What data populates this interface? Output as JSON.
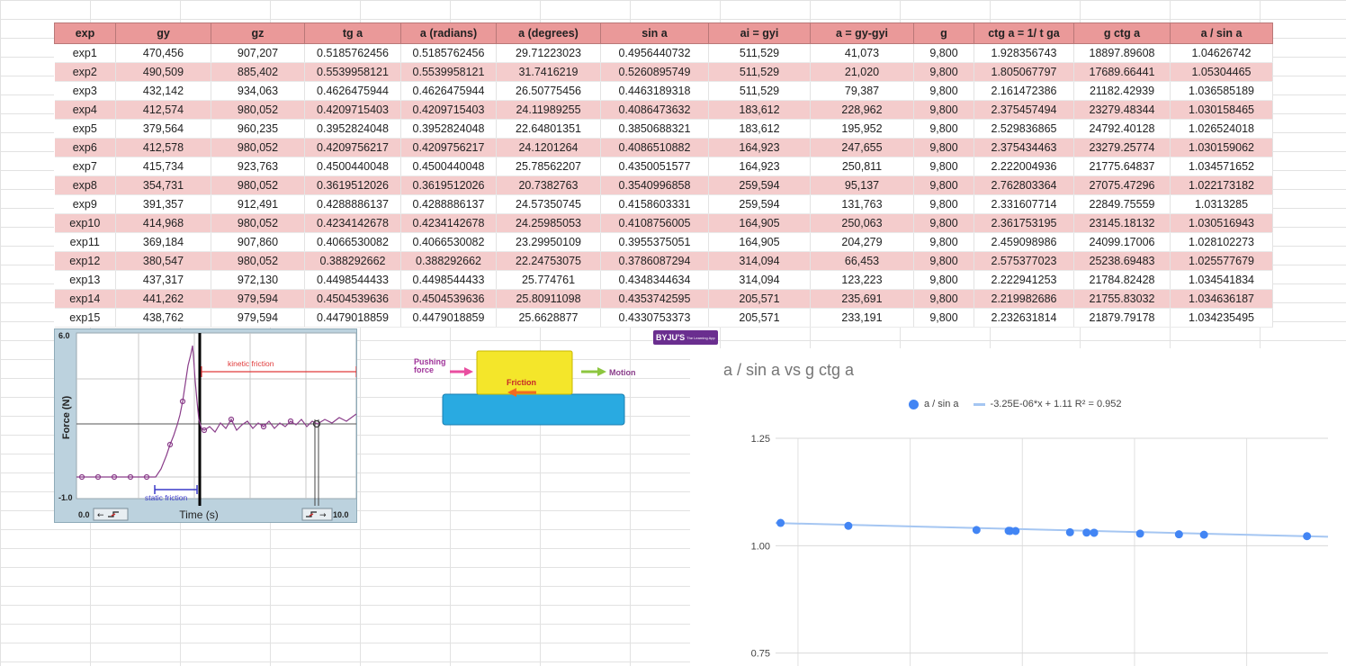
{
  "table": {
    "headers": [
      "exp",
      "gy",
      "gz",
      "tg a",
      "a (radians)",
      "a (degrees)",
      "sin a",
      "ai = gyi",
      "a = gy-gyi",
      "g",
      "ctg a = 1/ t ga",
      "g ctg a",
      "a / sin a"
    ],
    "col_widths": [
      68,
      106,
      104,
      107,
      106,
      116,
      120,
      113,
      115,
      67,
      111,
      107,
      114
    ],
    "rows": [
      [
        "exp1",
        "470,456",
        "907,207",
        "0.5185762456",
        "0.5185762456",
        "29.71223023",
        "0.4956440732",
        "511,529",
        "41,073",
        "9,800",
        "1.928356743",
        "18897.89608",
        "1.04626742"
      ],
      [
        "exp2",
        "490,509",
        "885,402",
        "0.5539958121",
        "0.5539958121",
        "31.7416219",
        "0.5260895749",
        "511,529",
        "21,020",
        "9,800",
        "1.805067797",
        "17689.66441",
        "1.05304465"
      ],
      [
        "exp3",
        "432,142",
        "934,063",
        "0.4626475944",
        "0.4626475944",
        "26.50775456",
        "0.4463189318",
        "511,529",
        "79,387",
        "9,800",
        "2.161472386",
        "21182.42939",
        "1.036585189"
      ],
      [
        "exp4",
        "412,574",
        "980,052",
        "0.4209715403",
        "0.4209715403",
        "24.11989255",
        "0.4086473632",
        "183,612",
        "228,962",
        "9,800",
        "2.375457494",
        "23279.48344",
        "1.030158465"
      ],
      [
        "exp5",
        "379,564",
        "960,235",
        "0.3952824048",
        "0.3952824048",
        "22.64801351",
        "0.3850688321",
        "183,612",
        "195,952",
        "9,800",
        "2.529836865",
        "24792.40128",
        "1.026524018"
      ],
      [
        "exp6",
        "412,578",
        "980,052",
        "0.4209756217",
        "0.4209756217",
        "24.1201264",
        "0.4086510882",
        "164,923",
        "247,655",
        "9,800",
        "2.375434463",
        "23279.25774",
        "1.030159062"
      ],
      [
        "exp7",
        "415,734",
        "923,763",
        "0.4500440048",
        "0.4500440048",
        "25.78562207",
        "0.4350051577",
        "164,923",
        "250,811",
        "9,800",
        "2.222004936",
        "21775.64837",
        "1.034571652"
      ],
      [
        "exp8",
        "354,731",
        "980,052",
        "0.3619512026",
        "0.3619512026",
        "20.7382763",
        "0.3540996858",
        "259,594",
        "95,137",
        "9,800",
        "2.762803364",
        "27075.47296",
        "1.022173182"
      ],
      [
        "exp9",
        "391,357",
        "912,491",
        "0.4288886137",
        "0.4288886137",
        "24.57350745",
        "0.4158603331",
        "259,594",
        "131,763",
        "9,800",
        "2.331607714",
        "22849.75559",
        "1.0313285"
      ],
      [
        "exp10",
        "414,968",
        "980,052",
        "0.4234142678",
        "0.4234142678",
        "24.25985053",
        "0.4108756005",
        "164,905",
        "250,063",
        "9,800",
        "2.361753195",
        "23145.18132",
        "1.030516943"
      ],
      [
        "exp11",
        "369,184",
        "907,860",
        "0.4066530082",
        "0.4066530082",
        "23.29950109",
        "0.3955375051",
        "164,905",
        "204,279",
        "9,800",
        "2.459098986",
        "24099.17006",
        "1.028102273"
      ],
      [
        "exp12",
        "380,547",
        "980,052",
        "0.388292662",
        "0.388292662",
        "22.24753075",
        "0.3786087294",
        "314,094",
        "66,453",
        "9,800",
        "2.575377023",
        "25238.69483",
        "1.025577679"
      ],
      [
        "exp13",
        "437,317",
        "972,130",
        "0.4498544433",
        "0.4498544433",
        "25.774761",
        "0.4348344634",
        "314,094",
        "123,223",
        "9,800",
        "2.222941253",
        "21784.82428",
        "1.034541834"
      ],
      [
        "exp14",
        "441,262",
        "979,594",
        "0.4504539636",
        "0.4504539636",
        "25.80911098",
        "0.4353742595",
        "205,571",
        "235,691",
        "9,800",
        "2.219982686",
        "21755.83032",
        "1.034636187"
      ],
      [
        "exp15",
        "438,762",
        "979,594",
        "0.4479018859",
        "0.4479018859",
        "25.6628877",
        "0.4330753373",
        "205,571",
        "233,191",
        "9,800",
        "2.232631814",
        "21879.79178",
        "1.034235495"
      ]
    ]
  },
  "friction_graph": {
    "y_axis_label": "Force (N)",
    "x_axis_label": "Time (s)",
    "y_max_label": "6.0",
    "y_min_label": "-1.0",
    "x_min_label": "0.0",
    "x_max_label": "10.0",
    "kinetic_label": "kinetic friction",
    "static_label": "static friction",
    "trace_color": "#8a3d8a",
    "kinetic_color": "#e03a3a",
    "static_color": "#3a3ac8"
  },
  "friction_diagram": {
    "pushing_label": "Pushing force",
    "pushing_line1": "Pushing",
    "pushing_line2": "force",
    "friction_label": "Friction",
    "motion_label": "Motion",
    "block_color": "#f4e62a",
    "surface_color": "#29aae1"
  },
  "logo": {
    "name": "BYJU'S",
    "tagline": "The Learning App"
  },
  "chart_data": {
    "type": "scatter",
    "title": "a / sin a vs g ctg a",
    "legend": "top-center",
    "series": [
      {
        "name": "a / sin a",
        "color": "#4285f4",
        "x": [
          18897.89608,
          17689.66441,
          21182.42939,
          23279.48344,
          24792.40128,
          23279.25774,
          21775.64837,
          27075.47296,
          22849.75559,
          23145.18132,
          24099.17006,
          25238.69483,
          21784.82428,
          21755.83032,
          21879.79178
        ],
        "y": [
          1.04626742,
          1.05304465,
          1.036585189,
          1.030158465,
          1.026524018,
          1.030159062,
          1.034571652,
          1.022173182,
          1.0313285,
          1.030516943,
          1.028102273,
          1.025577679,
          1.034541834,
          1.034636187,
          1.034235495
        ]
      }
    ],
    "trendline": {
      "label": "-3.25E-06*x + 1.11 R² = 0.952",
      "slope": -3.25e-06,
      "intercept": 1.11,
      "color": "#a5c6f2"
    },
    "xlim": [
      17600,
      27450
    ],
    "ylim": [
      0.72,
      1.25
    ],
    "y_ticks": [
      "1.25",
      "1.00",
      "0.75"
    ],
    "y_tick_values": [
      1.25,
      1.0,
      0.75
    ],
    "grid": true
  }
}
